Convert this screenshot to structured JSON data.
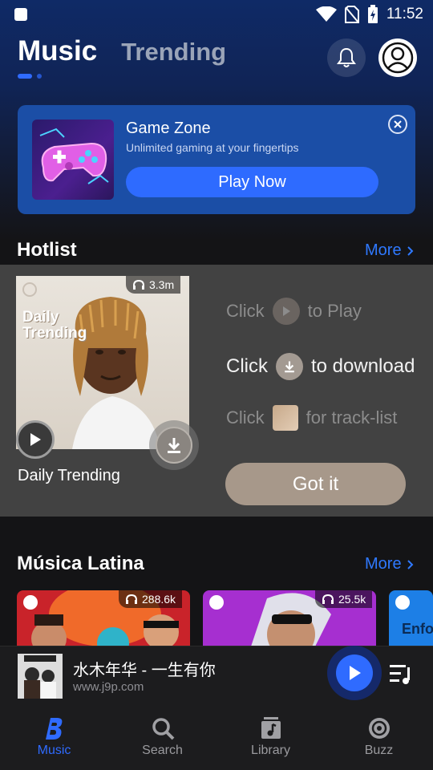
{
  "status_bar": {
    "time": "11:52"
  },
  "header": {
    "tabs": [
      {
        "label": "Music",
        "active": true
      },
      {
        "label": "Trending",
        "active": false
      }
    ]
  },
  "banner": {
    "title": "Game Zone",
    "subtitle": "Unlimited gaming at your fingertips",
    "button_label": "Play Now"
  },
  "hotlist": {
    "title": "Hotlist",
    "more_label": "More",
    "card": {
      "title": "Daily Trending",
      "cover_text_line1": "Daily",
      "cover_text_line2": "Trending",
      "listens": "3.3m"
    }
  },
  "onboarding": {
    "hint_play_prefix": "Click",
    "hint_play_suffix": "to Play",
    "hint_download_prefix": "Click",
    "hint_download_suffix": "to download",
    "hint_tracklist_prefix": "Click",
    "hint_tracklist_suffix": "for track-list",
    "got_it_label": "Got it"
  },
  "latina": {
    "title": "Música Latina",
    "more_label": "More",
    "cards": [
      {
        "listens": "288.6k",
        "color": "#c9232a"
      },
      {
        "listens": "25.5k",
        "color": "#a62fd0"
      },
      {
        "text": "Enfo",
        "color": "#1d7fe6"
      }
    ]
  },
  "mini_player": {
    "title": "水木年华 - 一生有你",
    "subtitle": "www.j9p.com"
  },
  "bottom_nav": [
    {
      "label": "Music",
      "icon": "boomplay-logo-icon",
      "active": true
    },
    {
      "label": "Search",
      "icon": "search-icon",
      "active": false
    },
    {
      "label": "Library",
      "icon": "library-icon",
      "active": false
    },
    {
      "label": "Buzz",
      "icon": "buzz-icon",
      "active": false
    }
  ],
  "colors": {
    "accent": "#2f6bff",
    "link": "#2f79ff",
    "got_it": "#a7988a"
  }
}
